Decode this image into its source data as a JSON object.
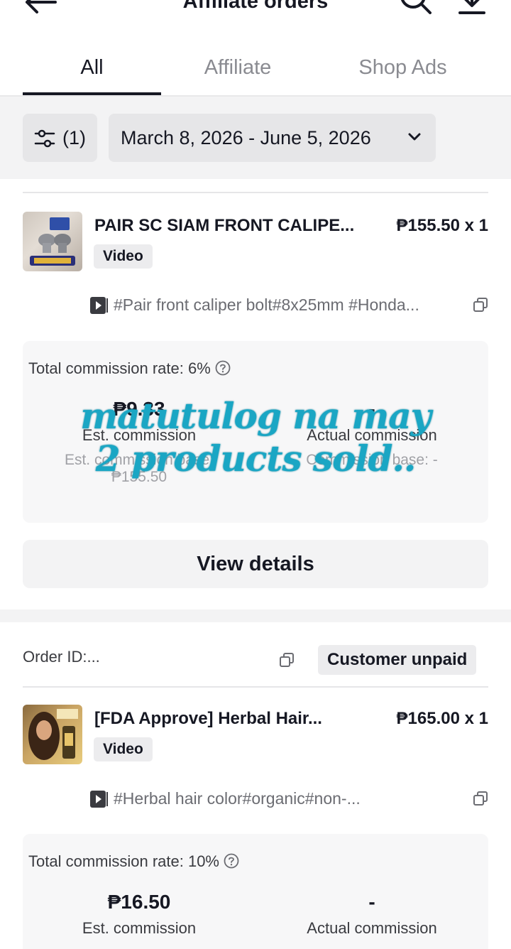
{
  "header": {
    "title": "Affiliate orders"
  },
  "tabs": [
    {
      "label": "All",
      "active": true
    },
    {
      "label": "Affiliate",
      "active": false
    },
    {
      "label": "Shop Ads",
      "active": false
    }
  ],
  "filters": {
    "filter_label": "(1)",
    "date_range": "March 8, 2026 - June 5, 2026"
  },
  "orders": [
    {
      "product_name": "PAIR SC SIAM FRONT CALIPE...",
      "price": "₱155.50 x 1",
      "badge": "Video",
      "video_tags": "#Pair front caliper bolt#8x25mm #Honda...",
      "commission_rate": "Total commission rate: 6%",
      "est_commission": "₱9.33",
      "est_label": "Est. commission",
      "actual_commission": "-",
      "actual_label": "Actual commission",
      "est_base": "Est. commission base:",
      "est_base_value": "₱155.50",
      "actual_base": "Commission base: -",
      "button": "View details"
    },
    {
      "order_id": "Order ID:...",
      "status": "Customer unpaid",
      "product_name": "[FDA Approve] Herbal Hair...",
      "price": "₱165.00 x 1",
      "badge": "Video",
      "video_tags": "#Herbal hair color#organic#non-...",
      "commission_rate": "Total commission rate: 10%",
      "est_commission": "₱16.50",
      "est_label": "Est. commission",
      "actual_commission": "-",
      "actual_label": "Actual commission"
    }
  ],
  "overlay_caption": [
    "matutulog na may",
    "2 products sold.."
  ],
  "colors": {
    "text": "#161823",
    "muted": "#8a8b91",
    "overlay": "#1aa6c4",
    "surface": "#f3f3f4"
  }
}
